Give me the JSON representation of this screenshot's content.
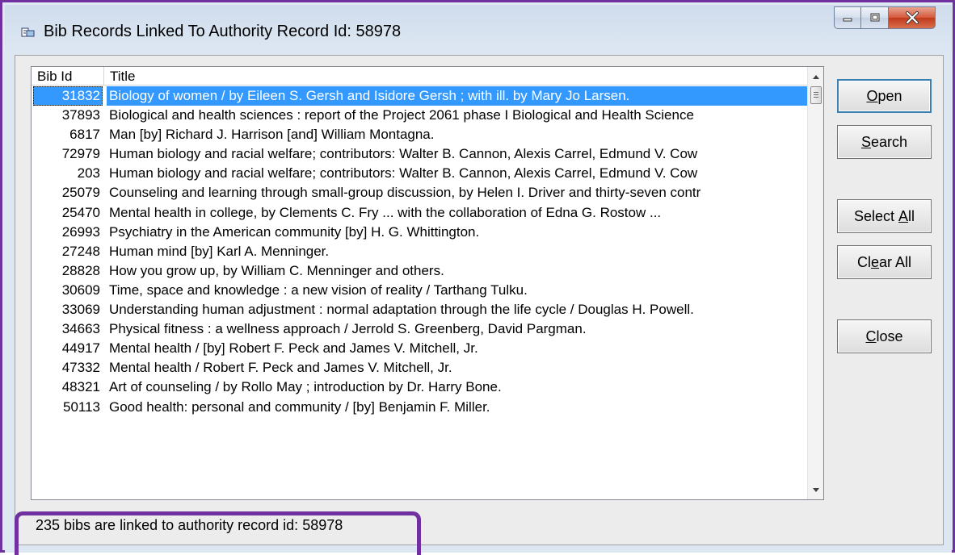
{
  "window": {
    "title": "Bib Records Linked To Authority Record Id: 58978"
  },
  "icons": {
    "title": "document-link-icon",
    "minimize": "minimize-icon",
    "maximize": "maximize-icon",
    "close": "close-x-icon"
  },
  "colors": {
    "highlight_frame": "#7030a0",
    "selection": "#3399ff",
    "close_button": "#c0381a"
  },
  "list": {
    "columns": [
      "Bib Id",
      "Title"
    ],
    "rows": [
      {
        "id": "31832",
        "title": "Biology of women / by Eileen S. Gersh and Isidore Gersh ; with ill. by Mary Jo Larsen.",
        "selected": true
      },
      {
        "id": "37893",
        "title": "Biological and health sciences : report of the Project 2061 phase I Biological and Health Science"
      },
      {
        "id": "6817",
        "title": "Man [by] Richard J. Harrison [and] William Montagna."
      },
      {
        "id": "72979",
        "title": "Human biology and racial welfare; contributors: Walter B. Cannon, Alexis Carrel, Edmund V. Cow"
      },
      {
        "id": "203",
        "title": "Human biology and racial welfare; contributors: Walter B. Cannon, Alexis Carrel, Edmund V. Cow"
      },
      {
        "id": "25079",
        "title": "Counseling and learning through small-group discussion, by Helen I. Driver and thirty-seven contr"
      },
      {
        "id": "25470",
        "title": "Mental health in college, by Clements C. Fry ... with the collaboration of Edna G. Rostow ..."
      },
      {
        "id": "26993",
        "title": "Psychiatry in the American community [by] H. G. Whittington."
      },
      {
        "id": "27248",
        "title": "Human mind [by] Karl A. Menninger."
      },
      {
        "id": "28828",
        "title": "How you grow up, by William C. Menninger and others."
      },
      {
        "id": "30609",
        "title": "Time, space and knowledge : a new vision of reality / Tarthang Tulku."
      },
      {
        "id": "33069",
        "title": "Understanding human adjustment : normal adaptation through the life cycle / Douglas H. Powell."
      },
      {
        "id": "34663",
        "title": "Physical fitness : a wellness approach / Jerrold S. Greenberg, David Pargman."
      },
      {
        "id": "44917",
        "title": "Mental health / [by] Robert F. Peck and James V. Mitchell, Jr."
      },
      {
        "id": "47332",
        "title": "Mental health / Robert F. Peck and James V. Mitchell, Jr."
      },
      {
        "id": "48321",
        "title": "Art of counseling / by Rollo May ; introduction by Dr. Harry Bone."
      },
      {
        "id": "50113",
        "title": "Good health: personal and community / [by] Benjamin F. Miller."
      }
    ]
  },
  "buttons": {
    "open": {
      "first": "O",
      "rest": "pen"
    },
    "search": {
      "first": "S",
      "rest": "earch"
    },
    "select_all": {
      "pre": "Select ",
      "u": "A",
      "post": "ll"
    },
    "clear_all": {
      "pre": "Cl",
      "u": "e",
      "post": "ar All"
    },
    "close": {
      "first": "C",
      "rest": "lose"
    }
  },
  "status": {
    "text": "235 bibs are linked to authority record id: 58978"
  }
}
